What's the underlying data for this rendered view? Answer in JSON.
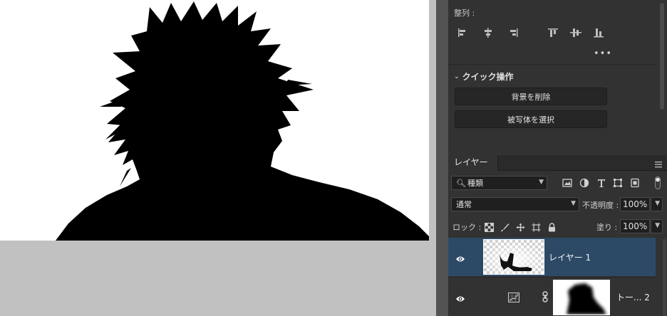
{
  "properties": {
    "align_label": "整列 :",
    "more_label": "•••",
    "align_icons": [
      "align-left-icon",
      "align-horizontal-center-icon",
      "align-right-icon",
      "align-top-icon",
      "align-vertical-center-icon",
      "align-bottom-icon"
    ],
    "quick_actions": {
      "title": "クイック操作",
      "remove_background": "背景を削除",
      "select_subject": "被写体を選択"
    }
  },
  "layers": {
    "tab_label": "レイヤー",
    "filter_kind": "種類",
    "blend_mode": "通常",
    "opacity_label": "不透明度 :",
    "opacity_value": "100%",
    "lock_label": "ロック :",
    "fill_label": "塗り :",
    "fill_value": "100%",
    "items": [
      {
        "name": "レイヤー 1",
        "selected": true
      },
      {
        "name": "トー... 2",
        "selected": false
      }
    ]
  },
  "colors": {
    "selected_row": "#2c4a66",
    "panel_bg": "#323232",
    "canvas_bg": "#c1c1c1"
  }
}
